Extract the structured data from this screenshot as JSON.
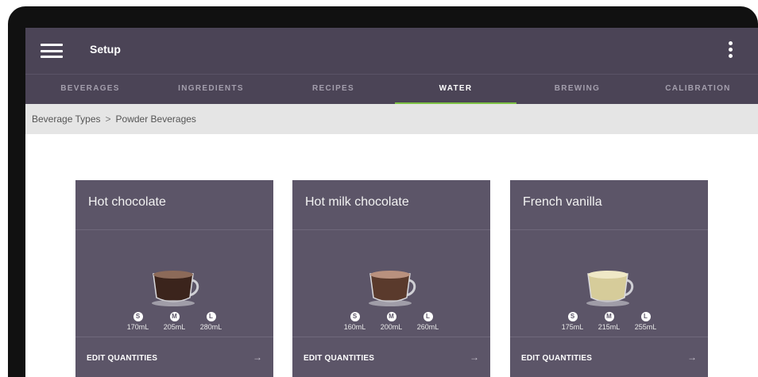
{
  "header": {
    "title": "Setup"
  },
  "tabs": [
    {
      "label": "BEVERAGES",
      "active": false
    },
    {
      "label": "INGREDIENTS",
      "active": false
    },
    {
      "label": "RECIPES",
      "active": false
    },
    {
      "label": "WATER",
      "active": true
    },
    {
      "label": "BREWING",
      "active": false
    },
    {
      "label": "CALIBRATION",
      "active": false
    }
  ],
  "breadcrumb": {
    "parent": "Beverage Types",
    "separator": ">",
    "current": "Powder Beverages"
  },
  "cards": [
    {
      "title": "Hot chocolate",
      "drink_color": "#3b241c",
      "foam_color": "#8c6a59",
      "sizes": [
        {
          "badge": "S",
          "amount": "170mL"
        },
        {
          "badge": "M",
          "amount": "205mL"
        },
        {
          "badge": "L",
          "amount": "280mL"
        }
      ],
      "action": "EDIT QUANTITIES",
      "arrow": "→"
    },
    {
      "title": "Hot milk chocolate",
      "drink_color": "#5a3a2c",
      "foam_color": "#b9917e",
      "sizes": [
        {
          "badge": "S",
          "amount": "160mL"
        },
        {
          "badge": "M",
          "amount": "200mL"
        },
        {
          "badge": "L",
          "amount": "260mL"
        }
      ],
      "action": "EDIT QUANTITIES",
      "arrow": "→"
    },
    {
      "title": "French vanilla",
      "drink_color": "#d6cc9a",
      "foam_color": "#efe8c6",
      "sizes": [
        {
          "badge": "S",
          "amount": "175mL"
        },
        {
          "badge": "M",
          "amount": "215mL"
        },
        {
          "badge": "L",
          "amount": "255mL"
        }
      ],
      "action": "EDIT QUANTITIES",
      "arrow": "→"
    }
  ],
  "colors": {
    "appbar": "#4b4456",
    "card": "#5c5568",
    "active_tab_underline": "#7cc043"
  }
}
